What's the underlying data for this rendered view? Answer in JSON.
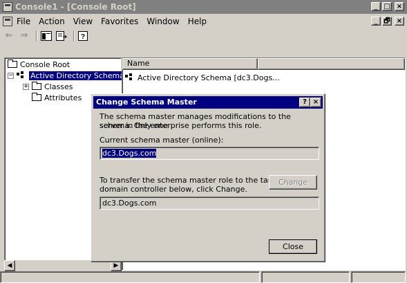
{
  "window": {
    "title": "Console1 - [Console Root]",
    "controls": [
      "_",
      "□",
      "×"
    ]
  },
  "menu": {
    "items": [
      "File",
      "Action",
      "View",
      "Favorites",
      "Window",
      "Help"
    ],
    "mdi_controls": [
      "_",
      "🗗",
      "×"
    ]
  },
  "toolbar": {
    "back_icon": "back-arrow-icon",
    "forward_icon": "forward-arrow-icon"
  },
  "tree": {
    "root": "Console Root",
    "schema": "Active Directory Schema",
    "classes": "Classes",
    "attributes": "Attributes",
    "classes_expander": "+",
    "schema_expander": "−"
  },
  "list": {
    "column_name": "Name",
    "rows": [
      "Active Directory Schema [dc3.Dogs..."
    ]
  },
  "dialog": {
    "title": "Change Schema Master",
    "help_button": "?",
    "close_x": "×",
    "intro_line1": "The schema master manages modifications to the schema. Only one",
    "intro_line2": "server in the enterprise performs this role.",
    "current_label": "Current schema master (online):",
    "current_value": "dc3.Dogs.com",
    "transfer_line1": "To transfer the schema master role to the targeted",
    "transfer_line2": "domain controller below, click Change.",
    "target_value": "dc3.Dogs.com",
    "change_button": "Change",
    "close_button": "Close"
  },
  "colors": {
    "selection": "#000080",
    "face": "#d4d0c8"
  }
}
